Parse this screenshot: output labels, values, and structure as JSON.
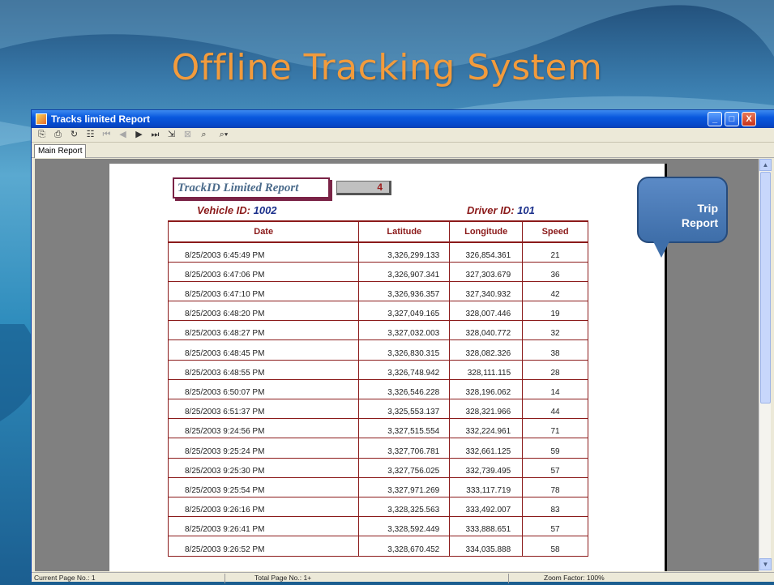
{
  "slide": {
    "title": "Offline Tracking System"
  },
  "window": {
    "title": "Tracks limited Report",
    "controls": [
      "_",
      "□",
      "X"
    ]
  },
  "toolbar": {
    "icons": [
      {
        "name": "export-icon",
        "glyph": "⎘",
        "enabled": true
      },
      {
        "name": "print-icon",
        "glyph": "⎙",
        "enabled": true
      },
      {
        "name": "refresh-icon",
        "glyph": "↻",
        "enabled": true
      },
      {
        "name": "group-tree-icon",
        "glyph": "☷",
        "enabled": true
      },
      {
        "name": "first-page-icon",
        "glyph": "⏮",
        "enabled": false
      },
      {
        "name": "previous-page-icon",
        "glyph": "◀",
        "enabled": false
      },
      {
        "name": "next-page-icon",
        "glyph": "▶",
        "enabled": true
      },
      {
        "name": "last-page-icon",
        "glyph": "⏭",
        "enabled": true
      },
      {
        "name": "goto-page-icon",
        "glyph": "⇲",
        "enabled": true
      },
      {
        "name": "stop-icon",
        "glyph": "⊠",
        "enabled": false
      },
      {
        "name": "search-icon",
        "glyph": "⌕",
        "enabled": true
      },
      {
        "name": "zoom-icon",
        "glyph": "⌕▾",
        "enabled": true
      }
    ]
  },
  "tabs": {
    "main": "Main Report"
  },
  "report": {
    "title": "TrackID Limited Report",
    "count": "4",
    "vehicle_label": "Vehicle ID:",
    "vehicle_value": "1002",
    "driver_label": "Driver ID:",
    "driver_value": "101",
    "columns": [
      "Date",
      "Latitude",
      "Longitude",
      "Speed"
    ],
    "rows": [
      [
        "8/25/2003 6:45:49 PM",
        "3,326,299.133",
        "326,854.361",
        "21"
      ],
      [
        "8/25/2003 6:47:06 PM",
        "3,326,907.341",
        "327,303.679",
        "36"
      ],
      [
        "8/25/2003 6:47:10 PM",
        "3,326,936.357",
        "327,340.932",
        "42"
      ],
      [
        "8/25/2003 6:48:20 PM",
        "3,327,049.165",
        "328,007.446",
        "19"
      ],
      [
        "8/25/2003 6:48:27 PM",
        "3,327,032.003",
        "328,040.772",
        "32"
      ],
      [
        "8/25/2003 6:48:45 PM",
        "3,326,830.315",
        "328,082.326",
        "38"
      ],
      [
        "8/25/2003 6:48:55 PM",
        "3,326,748.942",
        "328,111.115",
        "28"
      ],
      [
        "8/25/2003 6:50:07 PM",
        "3,326,546.228",
        "328,196.062",
        "14"
      ],
      [
        "8/25/2003 6:51:37 PM",
        "3,325,553.137",
        "328,321.966",
        "44"
      ],
      [
        "8/25/2003 9:24:56 PM",
        "3,327,515.554",
        "332,224.961",
        "71"
      ],
      [
        "8/25/2003 9:25:24 PM",
        "3,327,706.781",
        "332,661.125",
        "59"
      ],
      [
        "8/25/2003 9:25:30 PM",
        "3,327,756.025",
        "332,739.495",
        "57"
      ],
      [
        "8/25/2003 9:25:54 PM",
        "3,327,971.269",
        "333,117.719",
        "78"
      ],
      [
        "8/25/2003 9:26:16 PM",
        "3,328,325.563",
        "333,492.007",
        "83"
      ],
      [
        "8/25/2003 9:26:41 PM",
        "3,328,592.449",
        "333,888.651",
        "57"
      ],
      [
        "8/25/2003 9:26:52 PM",
        "3,328,670.452",
        "334,035.888",
        "58"
      ]
    ]
  },
  "callout": {
    "line1": "Trip",
    "line2": "Report"
  },
  "status": {
    "current_page": "Current Page No.: 1",
    "total_page": "Total Page No.: 1+",
    "zoom": "Zoom Factor: 100%"
  },
  "colors": {
    "title_orange": "#f29b3c",
    "report_maroon": "#8b1a1a",
    "report_blue": "#1a2f8b",
    "xp_blue": "#0858de",
    "callout_blue": "#4a7ab8"
  }
}
